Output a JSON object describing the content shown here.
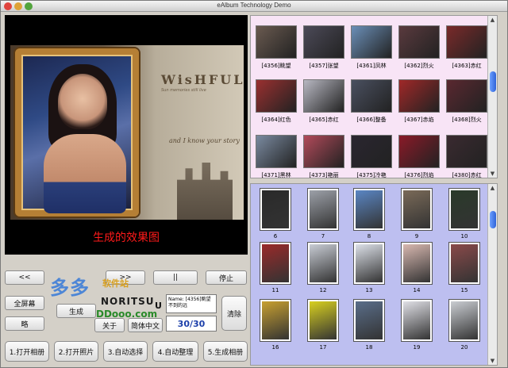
{
  "window": {
    "title": "eAlbum Technology Demo"
  },
  "preview": {
    "brand": "WisHFUL",
    "brand_sub": "Sun memories still live",
    "tagline": "and I know your story",
    "caption": "生成的效果图"
  },
  "controls": {
    "prev_label": "<<",
    "next_label": ">>",
    "pause_label": "||",
    "stop_label": "停止",
    "fullscreen_label": "全屏幕",
    "small_label": "略",
    "generate_label": "生成",
    "about_label": "关于",
    "simp_trad_label": "简体中文",
    "clear_label": "清除",
    "name_text": "Name: [4356]眺望不到的远",
    "counter": "30/30",
    "u_label": "U"
  },
  "watermark": {
    "brand": "多多",
    "site": "软件站",
    "noritsu": "NORITSU",
    "url": "DDooo.com"
  },
  "steps": [
    {
      "label": "1.打开相册"
    },
    {
      "label": "2.打开照片"
    },
    {
      "label": "3.自动选择"
    },
    {
      "label": "4.自动整理"
    },
    {
      "label": "5.生成相册"
    }
  ],
  "album_top": [
    {
      "caption": "[4356]眺望",
      "color": "#6a5a50"
    },
    {
      "caption": "[4357]张望",
      "color": "#4c4a58"
    },
    {
      "caption": "[4361]凤林",
      "color": "#6b8fb8"
    },
    {
      "caption": "[4362]烈火",
      "color": "#5a3a3e"
    },
    {
      "caption": "[4363]赤红",
      "color": "#7a2a2a"
    },
    {
      "caption": "[4364]红色",
      "color": "#9a3030"
    },
    {
      "caption": "[4365]赤红",
      "color": "#b8b8c2"
    },
    {
      "caption": "[4366]整备",
      "color": "#4a5060"
    },
    {
      "caption": "[4367]赤焰",
      "color": "#a02828"
    },
    {
      "caption": "[4368]烈火",
      "color": "#5a2830"
    },
    {
      "caption": "[4371]黑林",
      "color": "#7a8aa0"
    },
    {
      "caption": "[4373]艳丽",
      "color": "#b24a5a"
    },
    {
      "caption": "[4375]冷艳",
      "color": "#2a2630"
    },
    {
      "caption": "[4376]烈焰",
      "color": "#8a1a28"
    },
    {
      "caption": "[4380]赤红",
      "color": "#3a2a30"
    }
  ],
  "album_bot": [
    {
      "caption": "6",
      "color": "#2a2a2a"
    },
    {
      "caption": "7",
      "color": "#9ca0a8"
    },
    {
      "caption": "8",
      "color": "#5a86c4"
    },
    {
      "caption": "9",
      "color": "#7a6a58"
    },
    {
      "caption": "10",
      "color": "#2a3a2a"
    },
    {
      "caption": "11",
      "color": "#9a2a2a"
    },
    {
      "caption": "12",
      "color": "#c8ccd4"
    },
    {
      "caption": "13",
      "color": "#dce0e8"
    },
    {
      "caption": "14",
      "color": "#d8b8b0"
    },
    {
      "caption": "15",
      "color": "#8a4a4a"
    },
    {
      "caption": "16",
      "color": "#c8a030"
    },
    {
      "caption": "17",
      "color": "#d8d020"
    },
    {
      "caption": "18",
      "color": "#5a6e8a"
    },
    {
      "caption": "19",
      "color": "#e0e0e6"
    },
    {
      "caption": "20",
      "color": "#cacdd2"
    }
  ]
}
